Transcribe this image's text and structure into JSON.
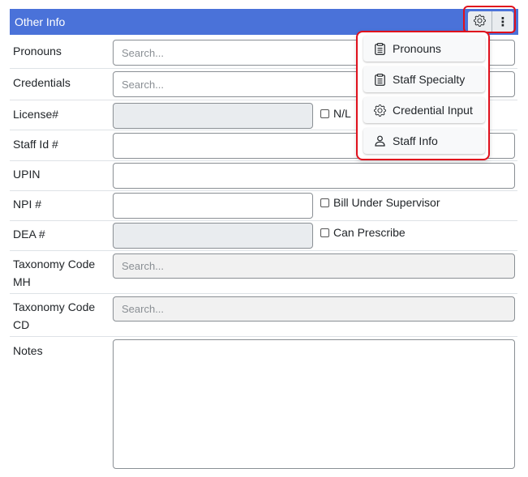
{
  "section": {
    "title": "Other Info",
    "gear_icon": "gear-icon",
    "more_icon": "vertical-ellipsis-icon",
    "more_glyph": "⋮"
  },
  "fields": {
    "pronouns": {
      "label": "Pronouns",
      "placeholder": "Search...",
      "value": ""
    },
    "credentials": {
      "label": "Credentials",
      "placeholder": "Search...",
      "value": ""
    },
    "license": {
      "label": "License#",
      "value": "",
      "checkbox_label": "N/L",
      "checked": false
    },
    "staff_id": {
      "label": "Staff Id #",
      "value": ""
    },
    "upin": {
      "label": "UPIN",
      "value": ""
    },
    "npi": {
      "label": "NPI #",
      "value": "",
      "checkbox_label": "Bill Under Supervisor",
      "checked": false
    },
    "dea": {
      "label": "DEA #",
      "value": "",
      "checkbox_label": "Can Prescribe",
      "checked": false
    },
    "taxonomy_mh": {
      "label_line1": "Taxonomy Code",
      "label_line2": "MH",
      "placeholder": "Search..."
    },
    "taxonomy_cd": {
      "label_line1": "Taxonomy Code",
      "label_line2": "CD",
      "placeholder": "Search..."
    },
    "notes": {
      "label": "Notes",
      "value": ""
    }
  },
  "dropdown_menu": {
    "items": [
      {
        "label": "Pronouns",
        "icon": "clipboard-icon"
      },
      {
        "label": "Staff Specialty",
        "icon": "clipboard-icon"
      },
      {
        "label": "Credential Input",
        "icon": "gear-icon"
      },
      {
        "label": "Staff Info",
        "icon": "user-icon"
      }
    ]
  },
  "colors": {
    "header_bg": "#4a72d9",
    "highlight_border": "#e0101c"
  }
}
